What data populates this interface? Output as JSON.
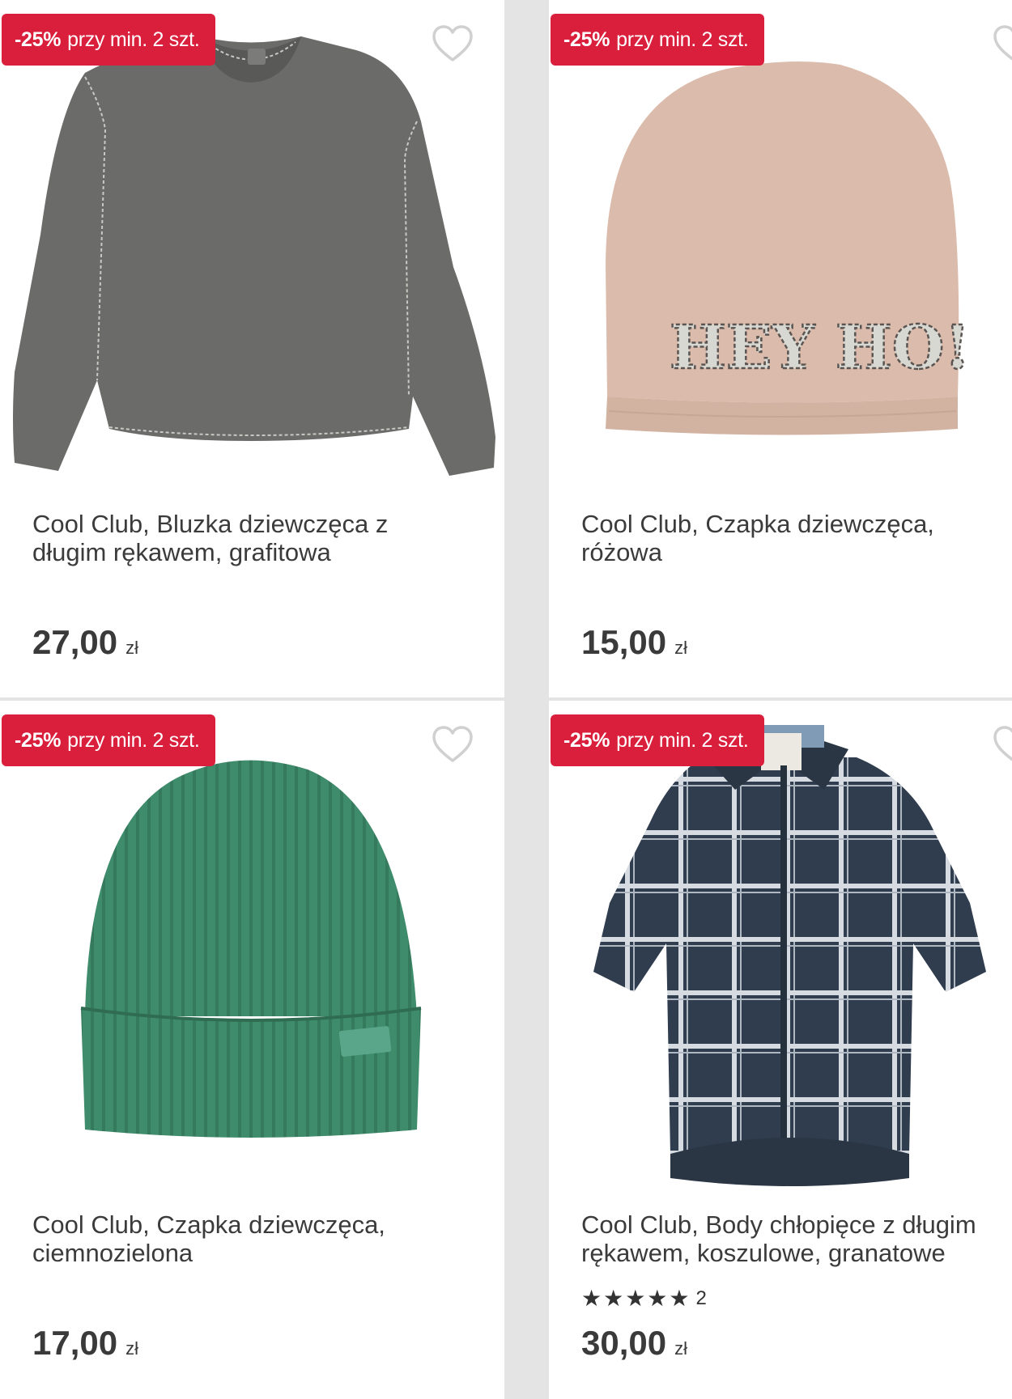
{
  "colors": {
    "badge": "#d91f3b",
    "background": "#e4e4e4",
    "card": "#ffffff"
  },
  "products": [
    {
      "badge_pct": "-25%",
      "badge_text": "przy min. 2 szt.",
      "title": "Cool Club, Bluzka dziewczęca z długim rękawem, grafitowa",
      "price": "27,00",
      "currency": "zł",
      "image": "grey-sweatshirt",
      "favorite_icon": "heart-outline-icon"
    },
    {
      "badge_pct": "-25%",
      "badge_text": "przy min. 2 szt.",
      "title": "Cool Club, Czapka dziewczęca, różowa",
      "price": "15,00",
      "currency": "zł",
      "image": "pink-beanie",
      "image_text": "HEY HO!",
      "favorite_icon": "heart-outline-icon"
    },
    {
      "badge_pct": "-25%",
      "badge_text": "przy min. 2 szt.",
      "title": "Cool Club, Czapka dziewczęca, ciemnozielona",
      "price": "17,00",
      "currency": "zł",
      "image": "green-knit-hat",
      "favorite_icon": "heart-outline-icon"
    },
    {
      "badge_pct": "-25%",
      "badge_text": "przy min. 2 szt.",
      "title": "Cool Club, Body chłopięce z długim rękawem, koszulowe, granatowe",
      "rating_stars": 5,
      "rating_count": "2",
      "price": "30,00",
      "currency": "zł",
      "image": "plaid-shirt-bodysuit",
      "favorite_icon": "heart-outline-icon"
    }
  ]
}
